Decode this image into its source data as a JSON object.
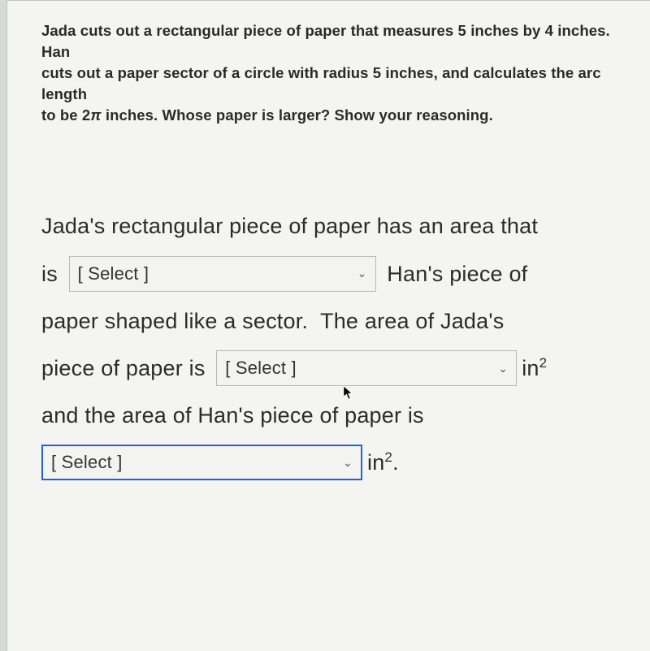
{
  "question": {
    "line1": "Jada cuts out a rectangular piece of paper that measures 5 inches by 4 inches. Han",
    "line2": "cuts out a paper sector of a circle with radius 5 inches, and calculates the arc length",
    "line3_a": "to be 2",
    "line3_pi": "π",
    "line3_b": " inches. Whose paper is larger? Show your reasoning."
  },
  "answer": {
    "part1": "Jada's rectangular piece of paper has an area that",
    "part2a": "is ",
    "part2b": " Han's piece of",
    "part3": "paper shaped like a sector.  The area of Jada's",
    "part4a": "piece of paper is ",
    "part4b_unit": " in",
    "part4b_sup": "2",
    "part5": "and the area of Han's piece of paper is",
    "part6_unit": " in",
    "part6_sup": "2",
    "part6_period": "."
  },
  "select": {
    "placeholder": "[ Select ]"
  }
}
